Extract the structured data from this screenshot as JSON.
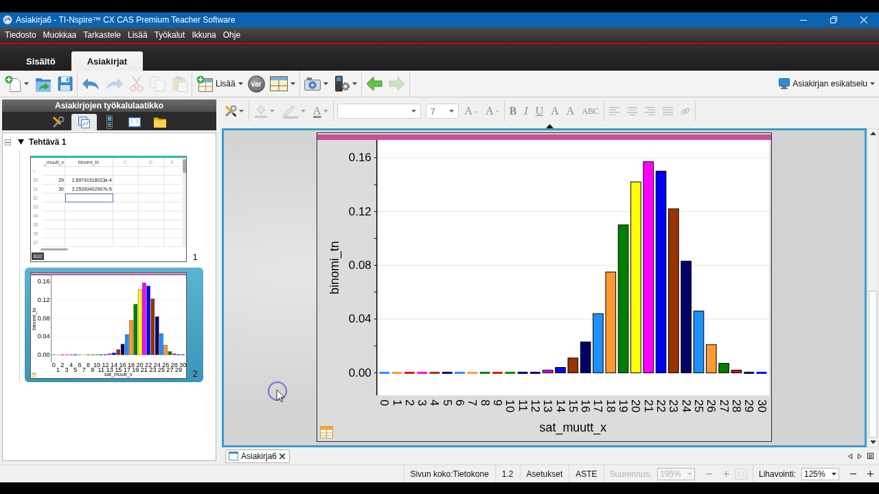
{
  "window": {
    "title": "Asiakirja6 - TI-Nspire™ CX CAS Premium Teacher Software"
  },
  "menu": [
    "Tiedosto",
    "Muokkaa",
    "Tarkastele",
    "Lisää",
    "Työkalut",
    "Ikkuna",
    "Ohje"
  ],
  "tabs": [
    {
      "label": "Sisältö",
      "selected": false
    },
    {
      "label": "Asiakirjat",
      "selected": true
    }
  ],
  "toolbar": {
    "groups": [
      [
        {
          "kind": "new",
          "menu": true,
          "disabled": false
        },
        {
          "kind": "open",
          "menu": false,
          "disabled": false
        },
        {
          "kind": "save",
          "menu": false,
          "disabled": false
        }
      ],
      [
        {
          "kind": "undo",
          "menu": false,
          "disabled": false
        },
        {
          "kind": "redo",
          "menu": false,
          "disabled": true
        },
        {
          "kind": "cut",
          "menu": false,
          "disabled": true
        },
        {
          "kind": "copy",
          "menu": false,
          "disabled": true
        },
        {
          "kind": "paste",
          "menu": false,
          "disabled": true
        }
      ],
      [
        {
          "kind": "insert",
          "label": "Lisää",
          "menu": true,
          "disabled": false
        },
        {
          "kind": "variables",
          "label": "var",
          "menu": false,
          "disabled": false
        },
        {
          "kind": "layout",
          "menu": true,
          "disabled": false
        }
      ],
      [
        {
          "kind": "capture",
          "menu": true,
          "disabled": false
        },
        {
          "kind": "device",
          "menu": true,
          "disabled": false
        }
      ],
      [
        {
          "kind": "back",
          "menu": false,
          "disabled": false
        },
        {
          "kind": "forward",
          "menu": false,
          "disabled": true
        }
      ]
    ],
    "preview": {
      "label": "Asiakirjan esikatselu",
      "menu": true
    }
  },
  "toolbox": {
    "title": "Asiakirjojen työkalulaatikko",
    "tabs": [
      {
        "kind": "tools",
        "selected": false
      },
      {
        "kind": "page_sorter",
        "selected": true
      },
      {
        "kind": "handheld",
        "selected": false
      },
      {
        "kind": "library",
        "selected": false
      },
      {
        "kind": "files",
        "selected": false
      }
    ]
  },
  "page_sorter": {
    "problems": [
      {
        "label": "Tehtävä 1",
        "expanded": true,
        "pages": [
          {
            "kind": "spreadsheet",
            "number": "1",
            "selected": false,
            "columns": [
              "_muutt_x",
              "binomi_tn",
              "C",
              "D",
              "E"
            ],
            "formula_row": "=",
            "rows": [
              {
                "number": "30",
                "cells": [
                  {
                    "text": "29",
                    "selected": false
                  },
                  {
                    "text": "2.89791518023ᴇ-4",
                    "selected": false
                  }
                ]
              },
              {
                "number": "31",
                "cells": [
                  {
                    "text": "30",
                    "selected": false
                  },
                  {
                    "text": "2.25393402907ᴇ-5",
                    "selected": false
                  }
                ]
              },
              {
                "number": "32",
                "cells": [
                  {
                    "selected": false
                  },
                  {
                    "selected": true
                  }
                ]
              },
              {
                "number": "33"
              },
              {
                "number": "34"
              },
              {
                "number": "35"
              },
              {
                "number": "36"
              },
              {
                "number": "37"
              }
            ],
            "cell_reference": "B32"
          },
          {
            "kind": "graph",
            "number": "2",
            "selected": true,
            "chart_data": {
              "type": "bar",
              "xlabel": "sat_muutt_x",
              "ylabel": "binomi_tn",
              "categories": [
                "0",
                "1",
                "2",
                "3",
                "4",
                "5",
                "6",
                "7",
                "8",
                "9",
                "10",
                "11",
                "12",
                "13",
                "14",
                "15",
                "16",
                "17",
                "18",
                "19",
                "20",
                "21",
                "22",
                "23",
                "24",
                "25",
                "26",
                "27",
                "28",
                "29",
                "30"
              ],
              "values": [
                0,
                0,
                0,
                0,
                0,
                0,
                0,
                0,
                0,
                0,
                0,
                0,
                0,
                0.002,
                0.004,
                0.011,
                0.023,
                0.044,
                0.075,
                0.11,
                0.142,
                0.157,
                0.15,
                0.122,
                0.083,
                0.046,
                0.021,
                0.007,
                0.002,
                0,
                0
              ],
              "colors": [
                "#1e90ff",
                "#ff9933",
                "#dd1111",
                "#ff00ff",
                "#993300",
                "#000066",
                "#1e90ff",
                "#ff9933",
                "#008000",
                "#dd1111",
                "#008000",
                "#000066",
                "#000066",
                "#ff00ff",
                "#0000ff",
                "#993300",
                "#000066",
                "#1e90ff",
                "#ff9933",
                "#008000",
                "#ffff00",
                "#ff00ff",
                "#0000ff",
                "#993300",
                "#000066",
                "#1e90ff",
                "#ff9933",
                "#008000",
                "#dd1111",
                "#000066",
                "#0000ff"
              ],
              "ylim": [
                -0.0168,
                0.1732
              ],
              "yticks": [
                {
                  "value": 0,
                  "label": "0.00"
                },
                {
                  "value": 0.04,
                  "label": "0.04"
                },
                {
                  "value": 0.08,
                  "label": "0.08"
                },
                {
                  "value": 0.12,
                  "label": "0.12"
                },
                {
                  "value": 0.16,
                  "label": "0.16"
                }
              ],
              "grid": true
            }
          }
        ]
      }
    ]
  },
  "format_toolbar": {
    "groups": [
      [
        {
          "kind": "tools",
          "menu": true,
          "disabled": false
        }
      ],
      [
        {
          "kind": "fill_color",
          "menu": true,
          "disabled": true
        },
        {
          "kind": "line_color",
          "menu": true,
          "disabled": true
        },
        {
          "kind": "text_color",
          "label": "A",
          "menu": true,
          "disabled": true
        }
      ],
      [
        {
          "kind": "font_name",
          "menu": true,
          "disabled": false
        },
        {
          "kind": "font_size",
          "value": "7",
          "menu": true,
          "disabled": false
        },
        {
          "kind": "grow",
          "label": "A",
          "menu": false,
          "disabled": true
        },
        {
          "kind": "shrink",
          "label": "A",
          "menu": false,
          "disabled": true
        }
      ],
      [
        {
          "kind": "bold",
          "label": "B",
          "menu": false,
          "disabled": true
        },
        {
          "kind": "italic",
          "label": "I",
          "menu": false,
          "disabled": true
        },
        {
          "kind": "underline",
          "label": "U",
          "menu": false,
          "disabled": true
        },
        {
          "kind": "superscript",
          "label": "A",
          "menu": false,
          "disabled": true
        },
        {
          "kind": "subscript",
          "label": "A",
          "menu": false,
          "disabled": true
        },
        {
          "kind": "strikethrough",
          "label": "ABC",
          "menu": false,
          "disabled": true
        }
      ],
      [
        {
          "kind": "align_left",
          "menu": false,
          "disabled": true
        },
        {
          "kind": "align_center",
          "menu": false,
          "disabled": true
        },
        {
          "kind": "align_right",
          "menu": false,
          "disabled": true
        },
        {
          "kind": "justify",
          "menu": false,
          "disabled": true
        },
        {
          "kind": "link",
          "menu": false,
          "disabled": true
        }
      ]
    ]
  },
  "document": {
    "page": {
      "chart_data": {
        "type": "bar",
        "xlabel": "sat_muutt_x",
        "ylabel": "binomi_tn",
        "categories": [
          "0",
          "1",
          "2",
          "3",
          "4",
          "5",
          "6",
          "7",
          "8",
          "9",
          "10",
          "11",
          "12",
          "13",
          "14",
          "15",
          "16",
          "17",
          "18",
          "19",
          "20",
          "21",
          "22",
          "23",
          "24",
          "25",
          "26",
          "27",
          "28",
          "29",
          "30"
        ],
        "values": [
          0,
          0,
          0,
          0,
          0,
          0,
          0,
          0,
          0,
          0,
          0,
          0,
          0,
          0.002,
          0.004,
          0.011,
          0.023,
          0.044,
          0.075,
          0.11,
          0.142,
          0.157,
          0.15,
          0.122,
          0.083,
          0.046,
          0.021,
          0.007,
          0.002,
          0,
          0
        ],
        "colors": [
          "#1e90ff",
          "#ff9933",
          "#dd1111",
          "#ff00ff",
          "#993300",
          "#000066",
          "#1e90ff",
          "#ff9933",
          "#008000",
          "#dd1111",
          "#008000",
          "#000066",
          "#000066",
          "#ff00ff",
          "#0000ff",
          "#993300",
          "#000066",
          "#1e90ff",
          "#ff9933",
          "#008000",
          "#ffff00",
          "#ff00ff",
          "#0000ff",
          "#993300",
          "#000066",
          "#1e90ff",
          "#ff9933",
          "#008000",
          "#dd1111",
          "#000066",
          "#0000ff"
        ],
        "ylim": [
          -0.0168,
          0.1732
        ],
        "yticks": [
          {
            "value": 0,
            "label": "0.00"
          },
          {
            "value": 0.04,
            "label": "0.04"
          },
          {
            "value": 0.08,
            "label": "0.08"
          },
          {
            "value": 0.12,
            "label": "0.12"
          },
          {
            "value": 0.16,
            "label": "0.16"
          }
        ],
        "grid": true
      }
    }
  },
  "document_tabs": [
    {
      "label": "Asiakirja6",
      "selected": true
    }
  ],
  "status_bar": {
    "items": [
      {
        "kind": "page_size",
        "label": "Sivun koko:Tietokone",
        "disabled": false
      },
      {
        "kind": "version",
        "label": "1.2",
        "disabled": false
      },
      {
        "kind": "settings",
        "label": "Asetukset",
        "disabled": false
      },
      {
        "kind": "angle_mode",
        "label": "ASTE",
        "disabled": false
      },
      {
        "kind": "magnification",
        "label": "Suurennus:",
        "value": "195%",
        "disabled": true
      },
      {
        "kind": "text_boldness",
        "label": "Lihavointi:",
        "value": "125%",
        "disabled": false
      }
    ]
  }
}
